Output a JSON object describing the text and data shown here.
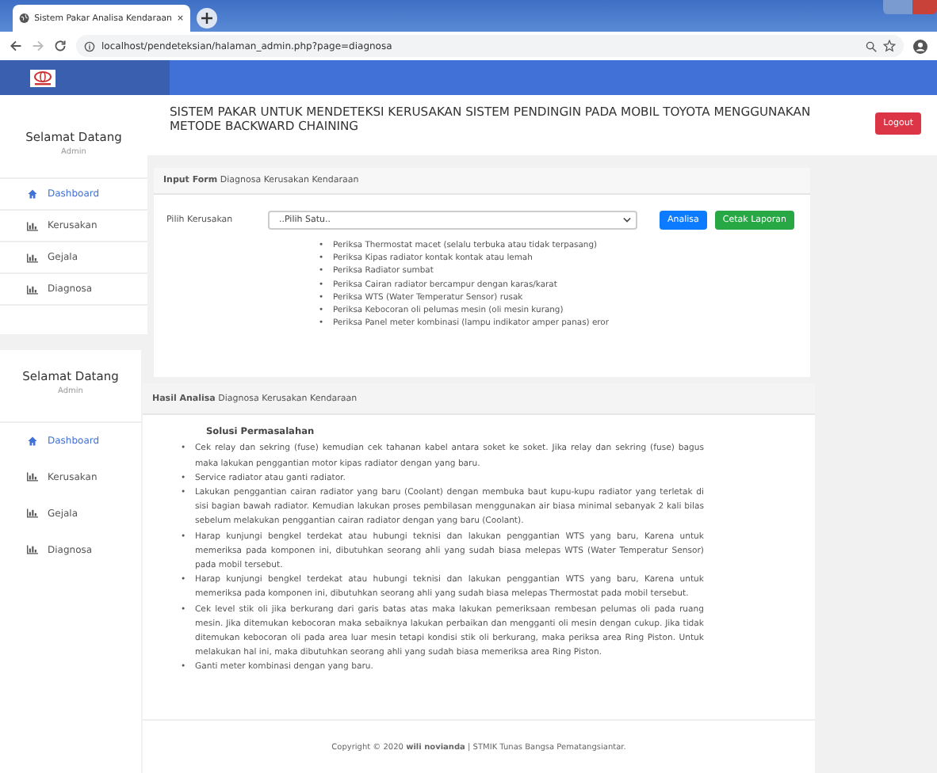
{
  "browser": {
    "tab_title": "Sistem Pakar Analisa Kendaraan",
    "tab_close": "×",
    "url": "localhost/pendeteksian/halaman_admin.php?page=diagnosa"
  },
  "header": {
    "title": "SISTEM PAKAR UNTUK MENDETEKSI KERUSAKAN SISTEM PENDINGIN PADA MOBIL TOYOTA MENGGUNAKAN METODE BACKWARD CHAINING",
    "logout": "Logout"
  },
  "sidebars": [
    {
      "greeting": "Selamat Datang",
      "role": "Admin",
      "items": [
        {
          "label": "Dashboard",
          "kind": "home",
          "selected": true
        },
        {
          "label": "Kerusakan",
          "kind": "chart",
          "selected": false
        },
        {
          "label": "Gejala",
          "kind": "chart",
          "selected": false
        },
        {
          "label": "Diagnosa",
          "kind": "chart",
          "selected": false
        }
      ]
    },
    {
      "greeting": "Selamat Datang",
      "role": "Admin",
      "items": [
        {
          "label": "Dashboard",
          "kind": "home",
          "selected": true
        },
        {
          "label": "Kerusakan",
          "kind": "chart",
          "selected": false
        },
        {
          "label": "Gejala",
          "kind": "chart",
          "selected": false
        },
        {
          "label": "Diagnosa",
          "kind": "chart",
          "selected": false
        }
      ]
    }
  ],
  "bullet": "•",
  "form": {
    "heading": "**Input Form** Diagnosa Kerusakan Kendaraan",
    "label": "Pilih Kerusakan",
    "select_value": "..Pilih Satu..",
    "buttons": [
      {
        "label": "Analisa",
        "kind": "primary"
      },
      {
        "label": "Cetak Laporan",
        "kind": "success"
      }
    ],
    "checks": [
      "Periksa Thermostat macet (selalu terbuka atau tidak terpasang)",
      "Periksa Kipas radiator kontak kontak atau lemah",
      "Periksa Radiator sumbat",
      "Periksa Cairan radiator bercampur dengan karas/karat",
      "Periksa WTS (Water Temperatur Sensor) rusak",
      "Periksa Kebocoran oli pelumas mesin (oli mesin kurang)",
      "Periksa Panel meter kombinasi (lampu indikator amper panas) eror"
    ]
  },
  "result": {
    "heading": "**Hasil Analisa** Diagnosa Kerusakan Kendaraan",
    "title": "Solusi Permasalahan",
    "solutions": [
      "Cek relay dan sekring (fuse) kemudian cek tahanan kabel antara soket ke soket. Jika relay dan sekring (fuse) bagus maka lakukan penggantian motor kipas radiator dengan yang baru.",
      "Service radiator atau ganti radiator.",
      "Lakukan penggantian cairan radiator yang baru (Coolant) dengan membuka baut kupu-kupu radiator yang terletak di sisi bagian bawah radiator. Kemudian lakukan proses pembilasan menggunakan air biasa minimal sebanyak 2 kali bilas sebelum melakukan penggantian cairan radiator dengan yang baru (Coolant).",
      "Harap kunjungi bengkel terdekat atau hubungi teknisi dan lakukan penggantian WTS yang baru, Karena untuk memeriksa pada komponen ini, dibutuhkan seorang ahli yang sudah biasa melepas WTS (Water Temperatur Sensor) pada mobil tersebut.",
      "Harap kunjungi bengkel terdekat atau hubungi teknisi dan lakukan penggantian WTS yang baru, Karena untuk memeriksa pada komponen ini, dibutuhkan seorang ahli yang sudah biasa melepas Thermostat pada mobil tersebut.",
      "Cek level stik oli jika berkurang dari garis batas atas maka lakukan pemeriksaan rembesan pelumas oli pada ruang mesin. Jika ditemukan kebocoran maka sebaiknya lakukan perbaikan dan mengganti oli mesin dengan cukup. Jika tidak ditemukan kebocoran oli pada area luar mesin tetapi kondisi stik oli berkurang, maka periksa area Ring Piston. Untuk melakukan hal ini, maka dibutuhkan seorang ahli yang sudah biasa memeriksa area Ring Piston.",
      "Ganti meter kombinasi dengan yang baru."
    ]
  },
  "footer": "Copyright © 2020 **wili novianda** | STMIK Tunas Bangsa Pematangsiantar."
}
